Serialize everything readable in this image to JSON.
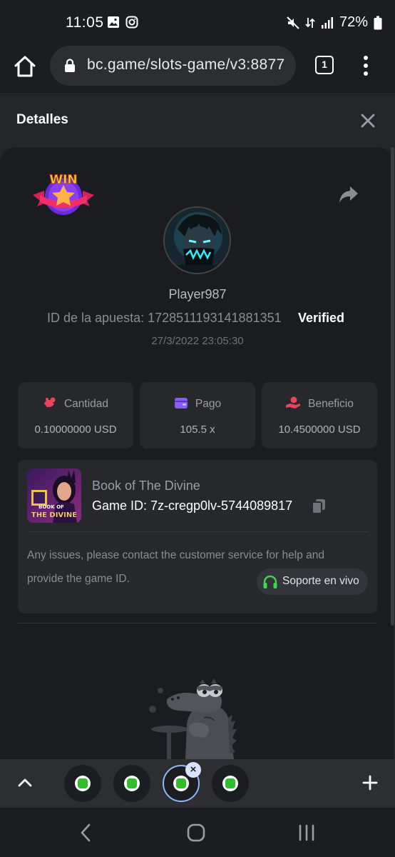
{
  "status_bar": {
    "time": "11:05",
    "battery": "72%"
  },
  "browser": {
    "url": "bc.game/slots-game/v3:8877",
    "tab_count": "1"
  },
  "panel": {
    "title": "Detalles"
  },
  "bet": {
    "player_name": "Player987",
    "bet_id_label": "ID de la apuesta:",
    "bet_id": "1728511193141881351",
    "bet_id_full": "ID de la apuesta: 1728511193141881351",
    "verified_label": "Verified",
    "datetime": "27/3/2022 23:05:30",
    "win_badge_text": "WIN"
  },
  "stats": [
    {
      "label": "Cantidad",
      "value": "0.10000000 USD",
      "icon": "coins-icon",
      "color": "#e8455d"
    },
    {
      "label": "Pago",
      "value": "105.5 x",
      "icon": "wallet-icon",
      "color": "#8a5cf6"
    },
    {
      "label": "Beneficio",
      "value": "10.4500000 USD",
      "icon": "hand-coin-icon",
      "color": "#e8455d"
    }
  ],
  "game": {
    "name": "Book of The Divine",
    "game_id_label": "Game ID:",
    "game_id": "7z-cregp0lv-5744089817",
    "game_id_full": "Game ID: 7z-cregp0lv-5744089817",
    "thumb_caption_1": "BOOK OF",
    "thumb_caption_2": "THE DIVINE",
    "issues_text": "Any issues, please contact the customer service for help and provide the game ID.",
    "support_label": "Soporte en vivo",
    "support_color": "#3dd84b"
  },
  "tabs": {
    "favicon_color": "#2fbf2a",
    "active_ring_color": "#8fb6ff"
  },
  "colors": {
    "background": "#1b1c1f",
    "card": "#26282c",
    "accent_red": "#e8455d",
    "accent_purple": "#8a5cf6"
  }
}
